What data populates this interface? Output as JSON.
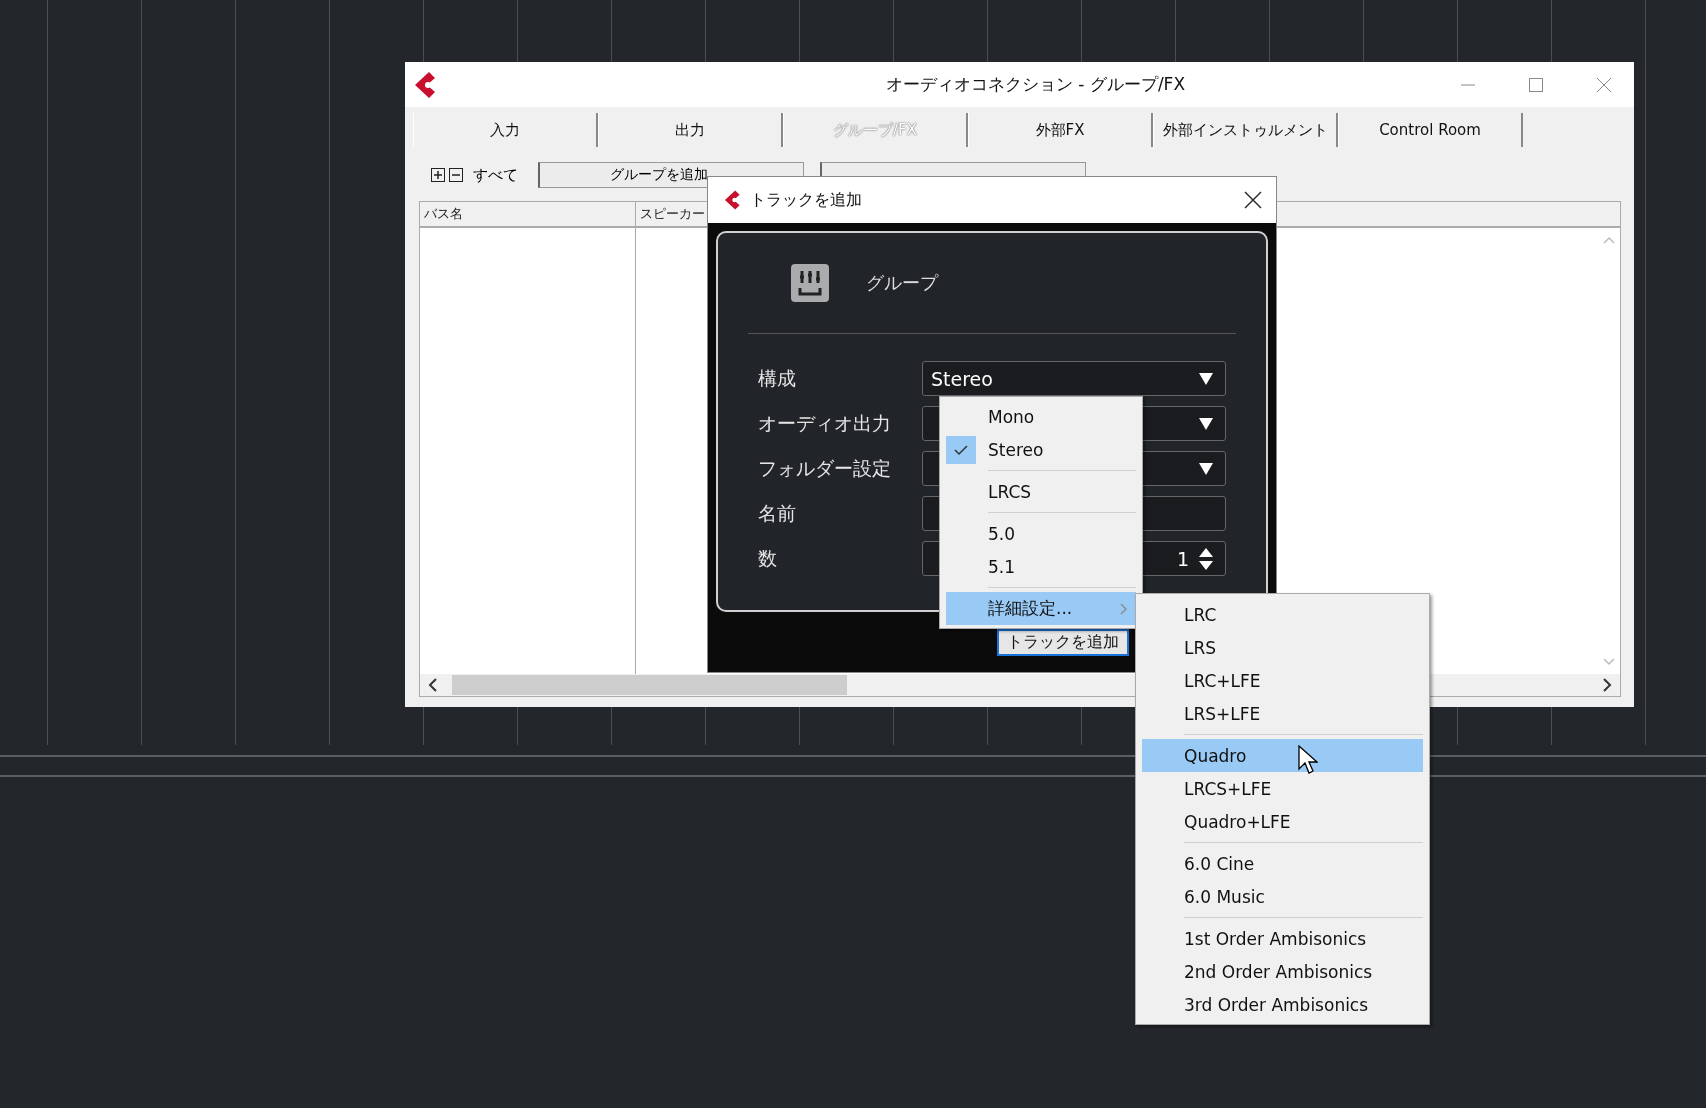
{
  "main_window": {
    "title": "オーディオコネクション - グループ/FX",
    "tabs": [
      {
        "label": "入力",
        "selected": false
      },
      {
        "label": "出力",
        "selected": false
      },
      {
        "label": "グループ/FX",
        "selected": true
      },
      {
        "label": "外部FX",
        "selected": false
      },
      {
        "label": "外部インストゥルメント",
        "selected": false
      },
      {
        "label": "Control Room",
        "selected": false
      }
    ],
    "toolbar": {
      "all_label": "すべて",
      "buttons": [
        "グループを追加"
      ]
    },
    "table": {
      "columns": [
        "バス名",
        "スピーカー"
      ]
    }
  },
  "dialog": {
    "title": "トラックを追加",
    "track_type": "グループ",
    "fields": [
      {
        "label": "構成",
        "kind": "dropdown",
        "value": "Stereo"
      },
      {
        "label": "オーディオ出力",
        "kind": "dropdown"
      },
      {
        "label": "フォルダー設定",
        "kind": "dropdown"
      },
      {
        "label": "名前",
        "kind": "text"
      },
      {
        "label": "数",
        "kind": "spinner",
        "value": "1"
      }
    ],
    "button": "トラックを追加"
  },
  "config_menu": {
    "items": [
      {
        "kind": "option",
        "label": "Mono",
        "checked": false,
        "selected": false
      },
      {
        "kind": "option",
        "label": "Stereo",
        "checked": true,
        "selected": false
      },
      {
        "kind": "separator"
      },
      {
        "kind": "option",
        "label": "LRCS",
        "checked": false,
        "selected": false
      },
      {
        "kind": "separator"
      },
      {
        "kind": "option",
        "label": "5.0",
        "checked": false,
        "selected": false
      },
      {
        "kind": "option",
        "label": "5.1",
        "checked": false,
        "selected": false
      },
      {
        "kind": "separator"
      },
      {
        "kind": "submenu",
        "label": "詳細設定...",
        "checked": false,
        "selected": true
      }
    ]
  },
  "submenu": {
    "items": [
      {
        "kind": "option",
        "label": "LRC",
        "selected": false
      },
      {
        "kind": "option",
        "label": "LRS",
        "selected": false
      },
      {
        "kind": "option",
        "label": "LRC+LFE",
        "selected": false
      },
      {
        "kind": "option",
        "label": "LRS+LFE",
        "selected": false
      },
      {
        "kind": "separator"
      },
      {
        "kind": "option",
        "label": "Quadro",
        "selected": true
      },
      {
        "kind": "option",
        "label": "LRCS+LFE",
        "selected": false
      },
      {
        "kind": "option",
        "label": "Quadro+LFE",
        "selected": false
      },
      {
        "kind": "separator"
      },
      {
        "kind": "option",
        "label": "6.0 Cine",
        "selected": false
      },
      {
        "kind": "option",
        "label": "6.0 Music",
        "selected": false
      },
      {
        "kind": "separator"
      },
      {
        "kind": "option",
        "label": "1st Order Ambisonics",
        "selected": false
      },
      {
        "kind": "option",
        "label": "2nd Order Ambisonics",
        "selected": false
      },
      {
        "kind": "option",
        "label": "3rd Order Ambisonics",
        "selected": false
      }
    ]
  }
}
